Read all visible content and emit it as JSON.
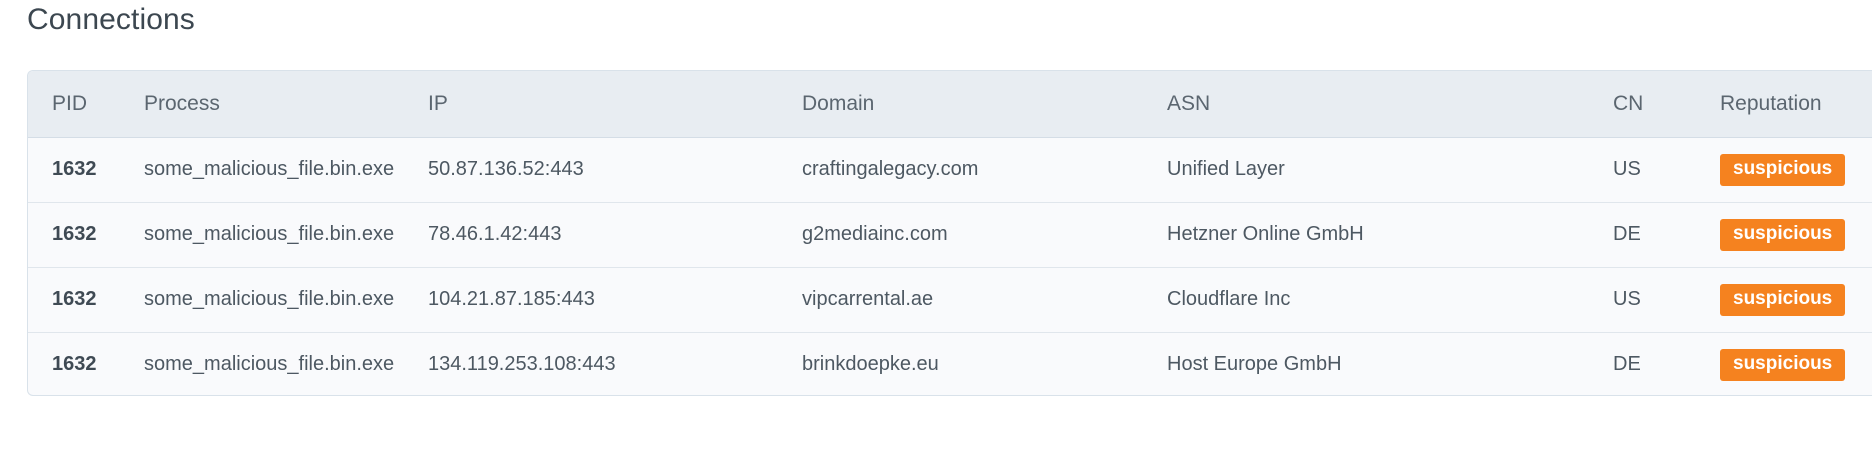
{
  "section": {
    "title": "Connections"
  },
  "table": {
    "columns": [
      "PID",
      "Process",
      "IP",
      "Domain",
      "ASN",
      "CN",
      "Reputation"
    ],
    "rows": [
      {
        "pid": "1632",
        "process": "some_malicious_file.bin.exe",
        "ip": "50.87.136.52:443",
        "domain": "craftingalegacy.com",
        "asn": "Unified Layer",
        "cn": "US",
        "reputation": "suspicious"
      },
      {
        "pid": "1632",
        "process": "some_malicious_file.bin.exe",
        "ip": "78.46.1.42:443",
        "domain": "g2mediainc.com",
        "asn": "Hetzner Online GmbH",
        "cn": "DE",
        "reputation": "suspicious"
      },
      {
        "pid": "1632",
        "process": "some_malicious_file.bin.exe",
        "ip": "104.21.87.185:443",
        "domain": "vipcarrental.ae",
        "asn": "Cloudflare Inc",
        "cn": "US",
        "reputation": "suspicious"
      },
      {
        "pid": "1632",
        "process": "some_malicious_file.bin.exe",
        "ip": "134.119.253.108:443",
        "domain": "brinkdoepke.eu",
        "asn": "Host Europe GmbH",
        "cn": "DE",
        "reputation": "suspicious"
      }
    ]
  },
  "colors": {
    "badge_suspicious": "#f5821f",
    "header_bg": "#e8edf2",
    "row_bg": "#f9fafc"
  }
}
